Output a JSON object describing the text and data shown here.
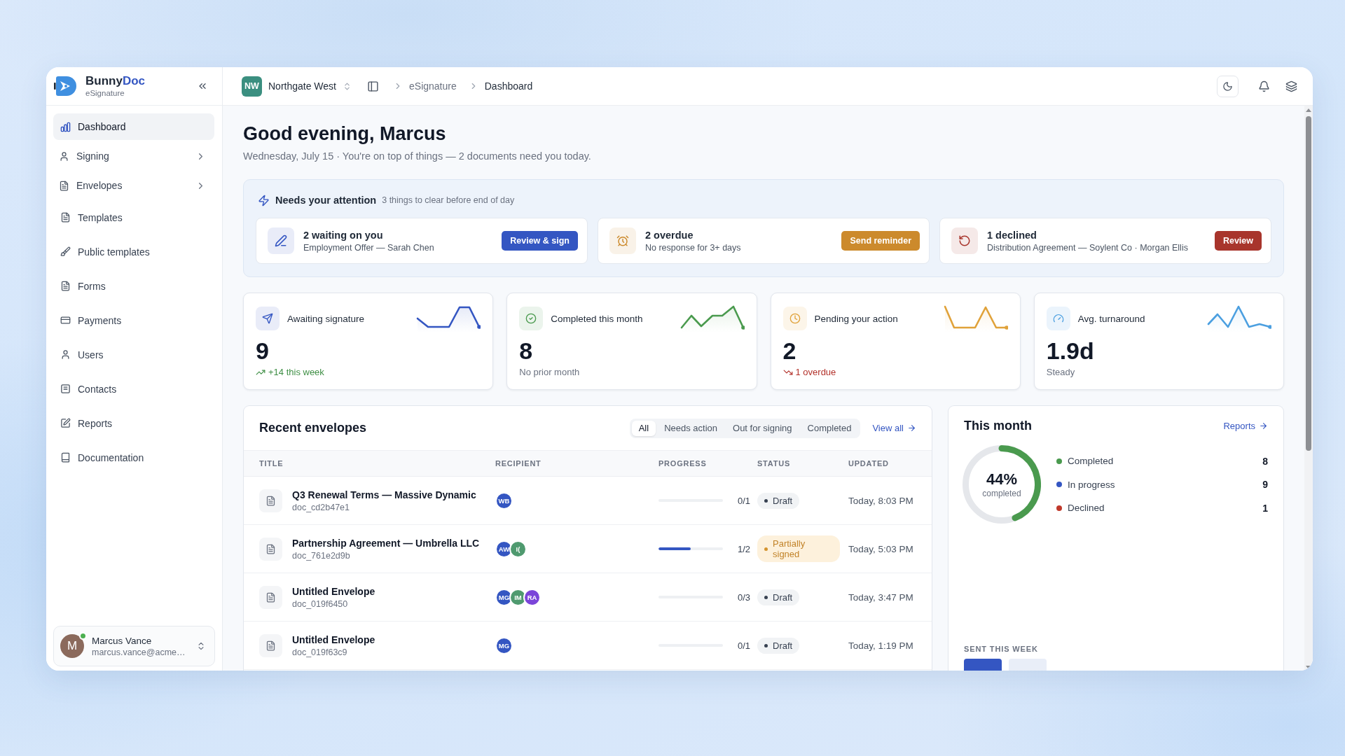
{
  "sidebar": {
    "brand": {
      "name": "Bunny",
      "name_accent": "Doc",
      "product": "eSignature"
    },
    "items": [
      {
        "label": "Dashboard",
        "kind": "link",
        "selected": true
      },
      {
        "label": "Signing",
        "kind": "group",
        "expanded": false,
        "selected": false
      },
      {
        "label": "Envelopes",
        "kind": "group",
        "expanded": false,
        "selected": false
      },
      {
        "label": "Templates",
        "kind": "link",
        "selected": false
      },
      {
        "label": "Public templates",
        "kind": "link",
        "selected": false
      },
      {
        "label": "Forms",
        "kind": "link",
        "selected": false
      },
      {
        "label": "Payments",
        "kind": "link",
        "selected": false
      },
      {
        "label": "Users",
        "kind": "link",
        "selected": false
      },
      {
        "label": "Contacts",
        "kind": "link",
        "selected": false
      },
      {
        "label": "Reports",
        "kind": "link",
        "selected": false
      },
      {
        "label": "Documentation",
        "kind": "link",
        "selected": false
      }
    ],
    "user": {
      "initial": "M",
      "name": "Marcus Vance",
      "email": "marcus.vance@acme…",
      "online": true
    }
  },
  "topbar": {
    "workspace": {
      "initials": "NW",
      "name": "Northgate West"
    },
    "breadcrumbs": [
      {
        "label": "eSignature",
        "current": false
      },
      {
        "label": "Dashboard",
        "current": true
      }
    ]
  },
  "greeting": {
    "title": "Good evening, Marcus",
    "subtitle": "Wednesday, July 15 · You're on top of things — 2 documents need you today."
  },
  "attention": {
    "title": "Needs your attention",
    "note": "3 things to clear before end of day",
    "items": [
      {
        "title": "2 waiting on you",
        "detail": "Employment Offer — Sarah Chen",
        "action": "Review & sign",
        "color": "#3456c2"
      },
      {
        "title": "2 overdue",
        "detail": "No response for 3+ days",
        "action": "Send reminder",
        "color": "#cc8a2c"
      },
      {
        "title": "1 declined",
        "detail": "Distribution Agreement — Soylent Co · Morgan Ellis",
        "action": "Review",
        "color": "#a8352c"
      }
    ]
  },
  "stats": [
    {
      "label": "Awaiting signature",
      "value": "9",
      "note": "+14 this week",
      "kind": "up",
      "color": "#3456c2"
    },
    {
      "label": "Completed this month",
      "value": "8",
      "note": "No prior month",
      "kind": "flat",
      "color": "#4a9a4e"
    },
    {
      "label": "Pending your action",
      "value": "2",
      "note": "1 overdue",
      "kind": "down",
      "color": "#e0a23a"
    },
    {
      "label": "Avg. turnaround",
      "value": "1.9d",
      "note": "Steady",
      "kind": "flat",
      "color": "#4b9fe0"
    }
  ],
  "envelopes": {
    "title": "Recent envelopes",
    "filters": [
      {
        "label": "All",
        "selected": true
      },
      {
        "label": "Needs action",
        "selected": false
      },
      {
        "label": "Out for signing",
        "selected": false
      },
      {
        "label": "Completed",
        "selected": false
      }
    ],
    "view_all": "View all",
    "columns": [
      "TITLE",
      "RECIPIENT",
      "PROGRESS",
      "STATUS",
      "UPDATED"
    ],
    "rows": [
      {
        "title": "Q3 Renewal Terms — Massive Dynamic",
        "doc_id": "doc_cd2b47e1",
        "recipients": [
          {
            "initials": "WB",
            "color": "#3456c2"
          }
        ],
        "progress": {
          "level": 0,
          "count": "0/1"
        },
        "status": {
          "label": "Draft",
          "kind": "draft"
        },
        "updated": "Today, 8:03 PM"
      },
      {
        "title": "Partnership Agreement — Umbrella LLC",
        "doc_id": "doc_761e2d9b",
        "recipients": [
          {
            "initials": "AW",
            "color": "#3456c2"
          },
          {
            "initials": "I(",
            "color": "#4f9a6f"
          }
        ],
        "progress": {
          "level": 0.5,
          "count": "1/2"
        },
        "status": {
          "label": "Partially signed",
          "kind": "partial"
        },
        "updated": "Today, 5:03 PM"
      },
      {
        "title": "Untitled Envelope",
        "doc_id": "doc_019f6450",
        "recipients": [
          {
            "initials": "MG",
            "color": "#3456c2"
          },
          {
            "initials": "IM",
            "color": "#4f9a6f"
          },
          {
            "initials": "RA",
            "color": "#7b45d9"
          }
        ],
        "progress": {
          "level": 0,
          "count": "0/3"
        },
        "status": {
          "label": "Draft",
          "kind": "draft"
        },
        "updated": "Today, 3:47 PM"
      },
      {
        "title": "Untitled Envelope",
        "doc_id": "doc_019f63c9",
        "recipients": [
          {
            "initials": "MG",
            "color": "#3456c2"
          }
        ],
        "progress": {
          "level": 0,
          "count": "0/1"
        },
        "status": {
          "label": "Draft",
          "kind": "draft"
        },
        "updated": "Today, 1:19 PM"
      }
    ]
  },
  "this_month": {
    "title": "This month",
    "link": "Reports",
    "ring": {
      "level": 0.44,
      "value": "44%",
      "caption": "completed"
    },
    "legend": [
      {
        "label": "Completed",
        "count": "8",
        "color": "#4a9a4e"
      },
      {
        "label": "In progress",
        "count": "9",
        "color": "#3456c2"
      },
      {
        "label": "Declined",
        "count": "1",
        "color": "#c0392b"
      }
    ],
    "sent_label": "SENT THIS WEEK"
  }
}
